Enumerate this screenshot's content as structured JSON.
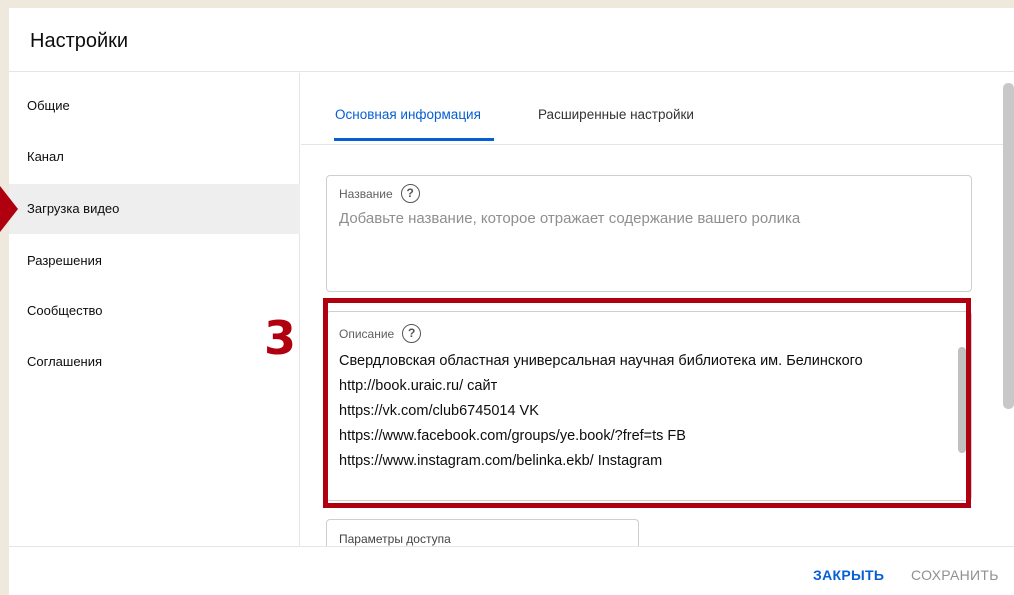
{
  "dialog": {
    "title": "Настройки"
  },
  "sidebar": {
    "items": [
      {
        "label": "Общие"
      },
      {
        "label": "Канал"
      },
      {
        "label": "Загрузка видео"
      },
      {
        "label": "Разрешения"
      },
      {
        "label": "Сообщество"
      },
      {
        "label": "Соглашения"
      }
    ],
    "active_index": 2
  },
  "tabs": [
    {
      "label": "Основная информация"
    },
    {
      "label": "Расширенные настройки"
    }
  ],
  "title_field": {
    "label": "Название",
    "help_icon": "question-circle-icon",
    "placeholder": "Добавьте название, которое отражает содержание вашего ролика"
  },
  "description_field": {
    "label": "Описание",
    "help_icon": "question-circle-icon",
    "lines": [
      "Свердловская областная универсальная научная библиотека им. Белинского",
      "http://book.uraic.ru/ сайт",
      "https://vk.com/club6745014 VK",
      "https://www.facebook.com/groups/ye.book/?fref=ts FB",
      "https://www.instagram.com/belinka.ekb/ Instagram"
    ]
  },
  "access_field": {
    "label": "Параметры доступа"
  },
  "footer": {
    "close_label": "ЗАКРЫТЬ",
    "save_label": "СОХРАНИТЬ"
  },
  "annotation": {
    "step_number": "3",
    "color": "#b00010"
  },
  "colors": {
    "accent": "#065fd4",
    "background": "#efe8dc"
  }
}
